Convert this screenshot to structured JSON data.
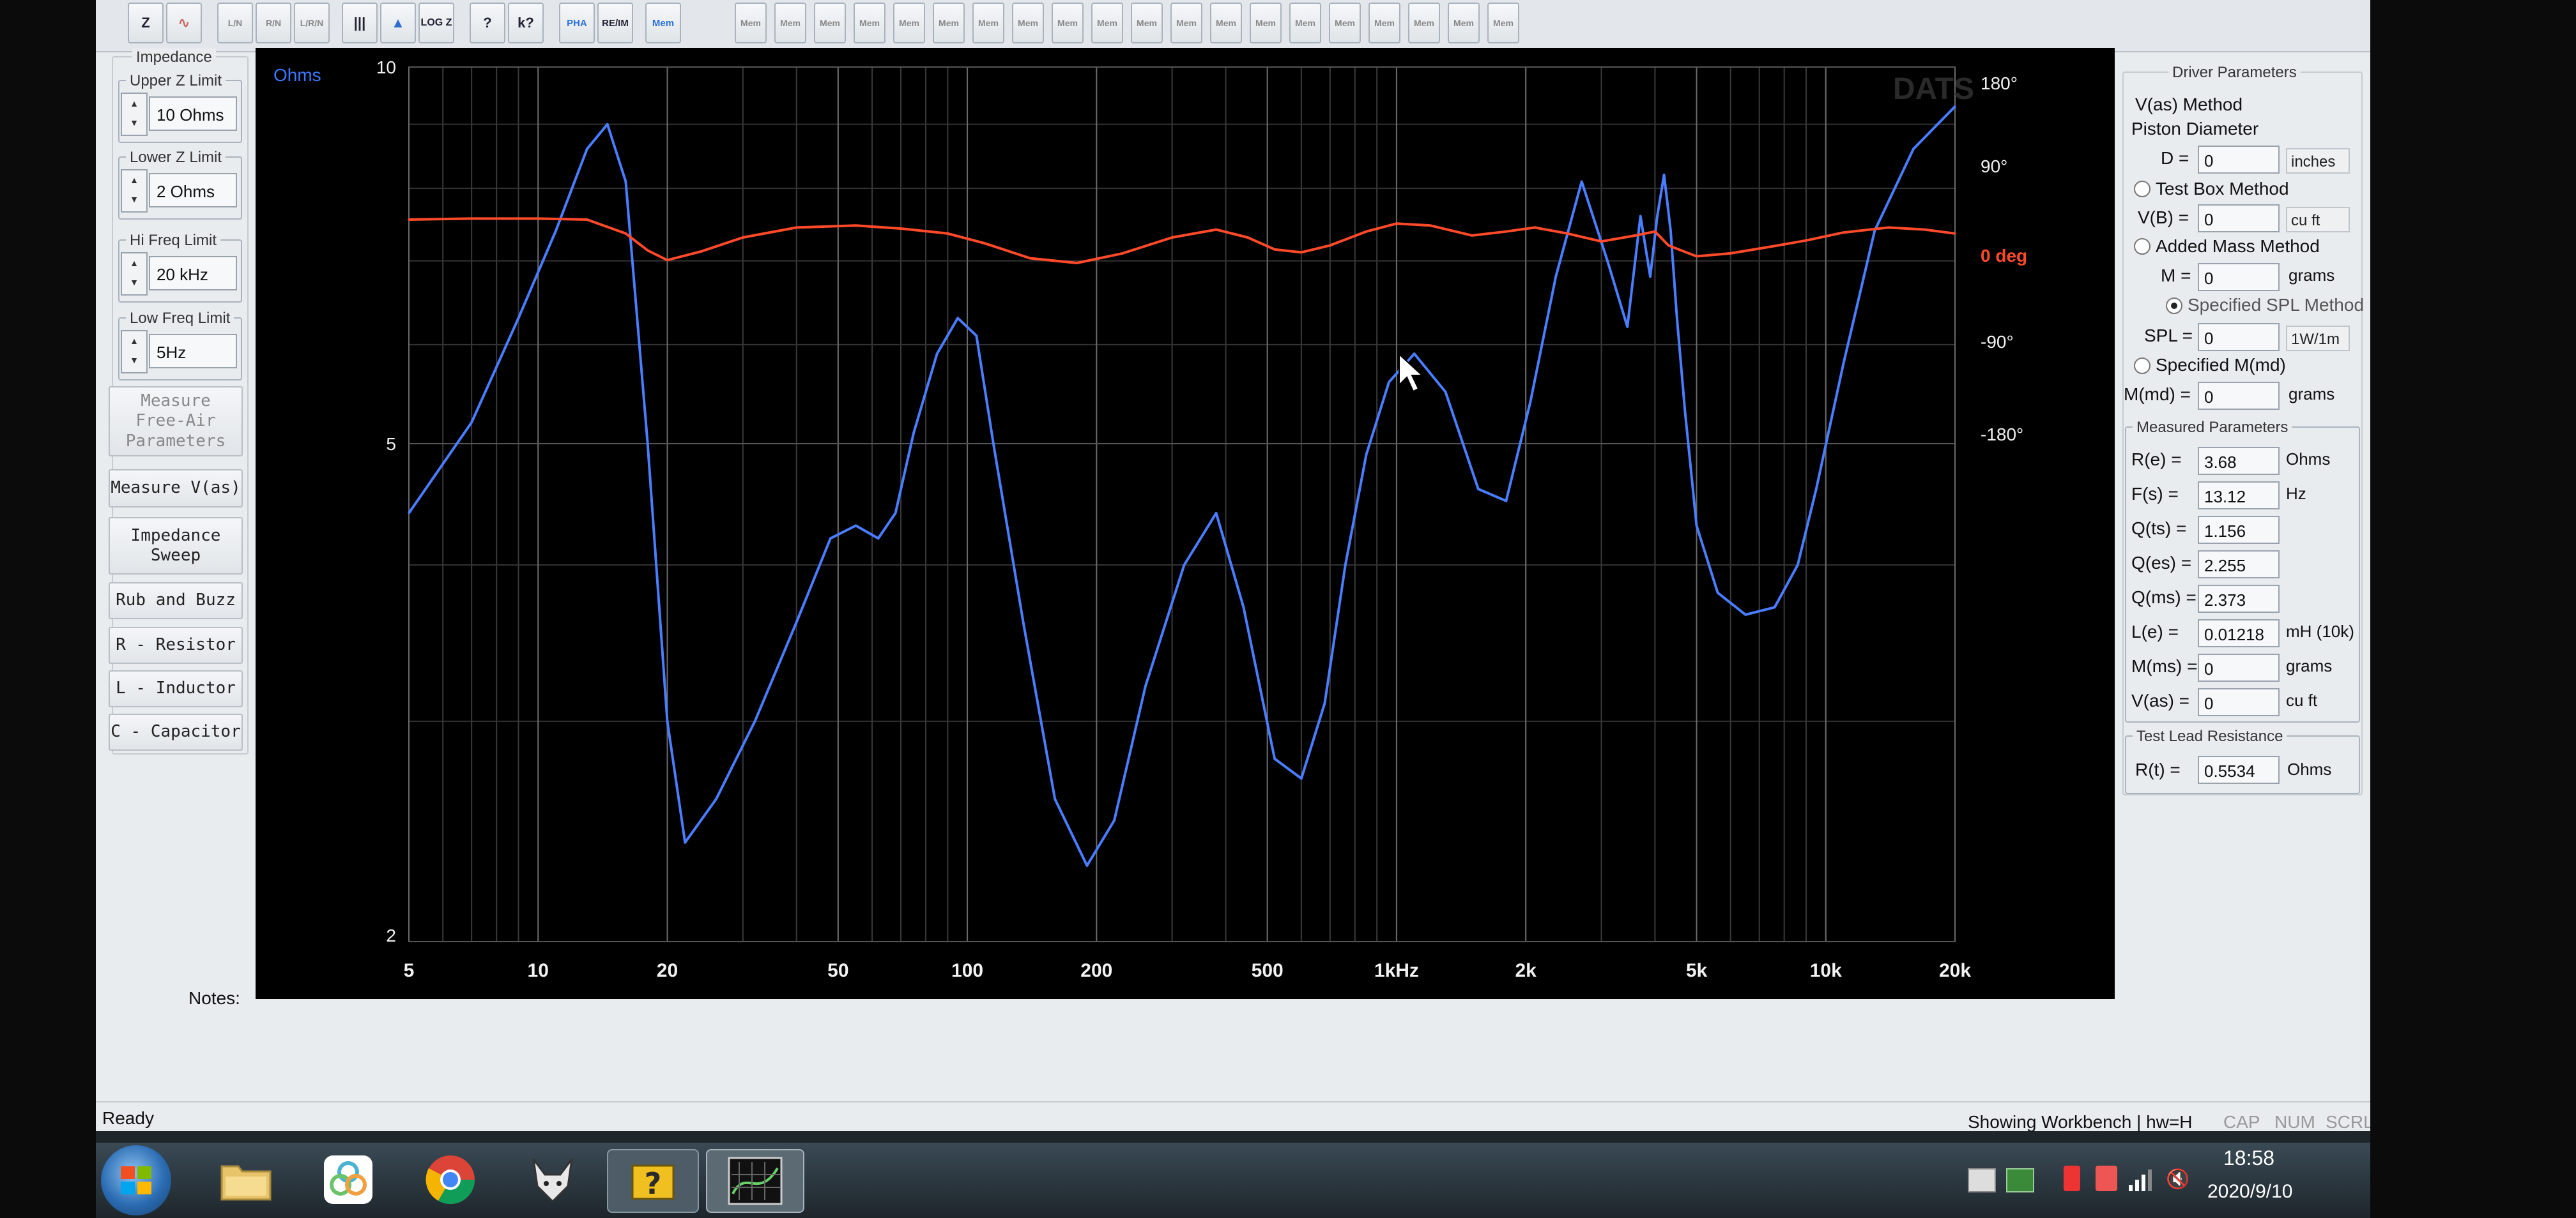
{
  "toolbar": {
    "buttons": [
      "Z",
      "∿",
      "L/N",
      "R/N",
      "L/R/N",
      "|||",
      "▲",
      "LOG Z",
      "?",
      "k?",
      "PHA",
      "RE/IM",
      "Mem"
    ],
    "mem_labels": [
      "Mem",
      "Mem",
      "Mem",
      "Mem",
      "Mem",
      "Mem",
      "Mem",
      "Mem",
      "Mem",
      "Mem",
      "Mem",
      "Mem",
      "Mem",
      "Mem",
      "Mem",
      "Mem",
      "Mem",
      "Mem",
      "Mem",
      "Mem"
    ]
  },
  "left_panel": {
    "title": "Impedance",
    "upper_z": {
      "label": "Upper Z Limit",
      "value": "10 Ohms"
    },
    "lower_z": {
      "label": "Lower Z Limit",
      "value": "2 Ohms"
    },
    "hi_freq": {
      "label": "Hi Freq Limit",
      "value": "20 kHz"
    },
    "low_freq": {
      "label": "Low Freq Limit",
      "value": "5Hz"
    },
    "buttons": {
      "measure_free_air": "Measure Free-Air Parameters",
      "measure_vas": "Measure V(as)",
      "impedance_sweep": "Impedance Sweep",
      "rub_buzz": "Rub and Buzz",
      "resistor": "R - Resistor",
      "inductor": "L - Inductor",
      "capacitor": "C - Capacitor"
    }
  },
  "chart_data": {
    "type": "line",
    "ylabel": "Ohms",
    "watermark": "DATS",
    "x_scale": "log",
    "xlim": [
      5,
      20000
    ],
    "ylim": [
      2,
      10
    ],
    "y_scale": "log",
    "phase_lim": [
      -180,
      180
    ],
    "x_ticks": [
      "5",
      "10",
      "20",
      "50",
      "100",
      "200",
      "500",
      "1kHz",
      "2k",
      "5k",
      "10k",
      "20k"
    ],
    "x_tick_values": [
      5,
      10,
      20,
      50,
      100,
      200,
      500,
      1000,
      2000,
      5000,
      10000,
      20000
    ],
    "y_ticks_left": [
      "10",
      "5",
      "2"
    ],
    "y_tick_values": [
      10,
      5,
      2
    ],
    "y_ticks_right": [
      "180°",
      "90°",
      "0 deg",
      "-90°",
      "-180°"
    ],
    "phase_tick_values": [
      180,
      90,
      0,
      -90,
      -180
    ],
    "grid": true,
    "series": [
      {
        "name": "Impedance",
        "color": "#4a7dff",
        "x": [
          5,
          7,
          9,
          11,
          13,
          14.5,
          16,
          18,
          20,
          22,
          26,
          32,
          40,
          48,
          55,
          62,
          68,
          75,
          85,
          95,
          105,
          115,
          135,
          160,
          190,
          220,
          260,
          320,
          380,
          440,
          520,
          600,
          680,
          760,
          850,
          960,
          1100,
          1300,
          1550,
          1800,
          2050,
          2350,
          2700,
          3100,
          3450,
          3700,
          3900,
          4050,
          4200,
          4350,
          4500,
          4700,
          5000,
          5600,
          6500,
          7600,
          8600,
          9500,
          11000,
          13000,
          16000,
          20000
        ],
        "y": [
          4.4,
          5.2,
          6.3,
          7.4,
          8.6,
          9.0,
          8.1,
          5.0,
          3.0,
          2.4,
          2.6,
          3.0,
          3.6,
          4.2,
          4.3,
          4.2,
          4.4,
          5.1,
          5.9,
          6.3,
          6.1,
          5.0,
          3.6,
          2.6,
          2.3,
          2.5,
          3.2,
          4.0,
          4.4,
          3.7,
          2.8,
          2.7,
          3.1,
          4.0,
          4.9,
          5.6,
          5.9,
          5.5,
          4.6,
          4.5,
          5.4,
          6.8,
          8.1,
          7.0,
          6.2,
          7.6,
          6.8,
          7.6,
          8.2,
          7.4,
          6.3,
          5.3,
          4.3,
          3.8,
          3.65,
          3.7,
          4.0,
          4.6,
          5.8,
          7.4,
          8.6,
          9.3
        ]
      },
      {
        "name": "Phase",
        "color": "#ff4a2a",
        "x": [
          5,
          7,
          10,
          13,
          16,
          18,
          20,
          24,
          30,
          40,
          55,
          70,
          90,
          110,
          140,
          180,
          230,
          300,
          380,
          450,
          520,
          600,
          700,
          850,
          1000,
          1200,
          1500,
          1800,
          2100,
          2500,
          3000,
          3600,
          4000,
          4300,
          4600,
          5000,
          6000,
          7500,
          9000,
          11000,
          14000,
          17000,
          20000
        ],
        "y": [
          36,
          37,
          37,
          36,
          22,
          5,
          -5,
          4,
          18,
          28,
          30,
          27,
          22,
          12,
          -3,
          -8,
          2,
          18,
          26,
          18,
          6,
          3,
          10,
          24,
          32,
          30,
          20,
          24,
          28,
          22,
          14,
          20,
          24,
          10,
          5,
          -1,
          2,
          9,
          15,
          23,
          28,
          26,
          22
        ]
      }
    ]
  },
  "right_panel": {
    "title": "Driver Parameters",
    "vas_method": "V(as) Method",
    "piston_diameter": "Piston Diameter",
    "D": {
      "label": "D =",
      "value": "0",
      "unit": "inches"
    },
    "test_box": "Test Box Method",
    "VB": {
      "label": "V(B) =",
      "value": "0",
      "unit": "cu ft"
    },
    "added_mass": "Added Mass Method",
    "M": {
      "label": "M =",
      "value": "0",
      "unit": "grams"
    },
    "specified_spl": "Specified SPL Method",
    "SPL": {
      "label": "SPL =",
      "value": "0",
      "unit": "1W/1m"
    },
    "specified_mmd": "Specified M(md)",
    "Mmd": {
      "label": "M(md) =",
      "value": "0",
      "unit": "grams"
    },
    "measured_title": "Measured Parameters",
    "measured": [
      {
        "label": "R(e) =",
        "value": "3.68",
        "unit": "Ohms"
      },
      {
        "label": "F(s) =",
        "value": "13.12",
        "unit": "Hz"
      },
      {
        "label": "Q(ts) =",
        "value": "1.156",
        "unit": ""
      },
      {
        "label": "Q(es) =",
        "value": "2.255",
        "unit": ""
      },
      {
        "label": "Q(ms) =",
        "value": "2.373",
        "unit": ""
      },
      {
        "label": "L(e) =",
        "value": "0.01218",
        "unit": "mH (10k)"
      },
      {
        "label": "M(ms) =",
        "value": "0",
        "unit": "grams"
      },
      {
        "label": "V(as) =",
        "value": "0",
        "unit": "cu ft"
      }
    ],
    "lead_title": "Test Lead Resistance",
    "Rt": {
      "label": "R(t) =",
      "value": "0.5534",
      "unit": "Ohms"
    }
  },
  "notes_label": "Notes:",
  "status": {
    "left": "Ready",
    "right": "Showing Workbench | hw=H",
    "indicators": [
      "CAP",
      "NUM",
      "SCRL"
    ]
  },
  "taskbar": {
    "time": "18:58",
    "date": "2020/9/10"
  }
}
